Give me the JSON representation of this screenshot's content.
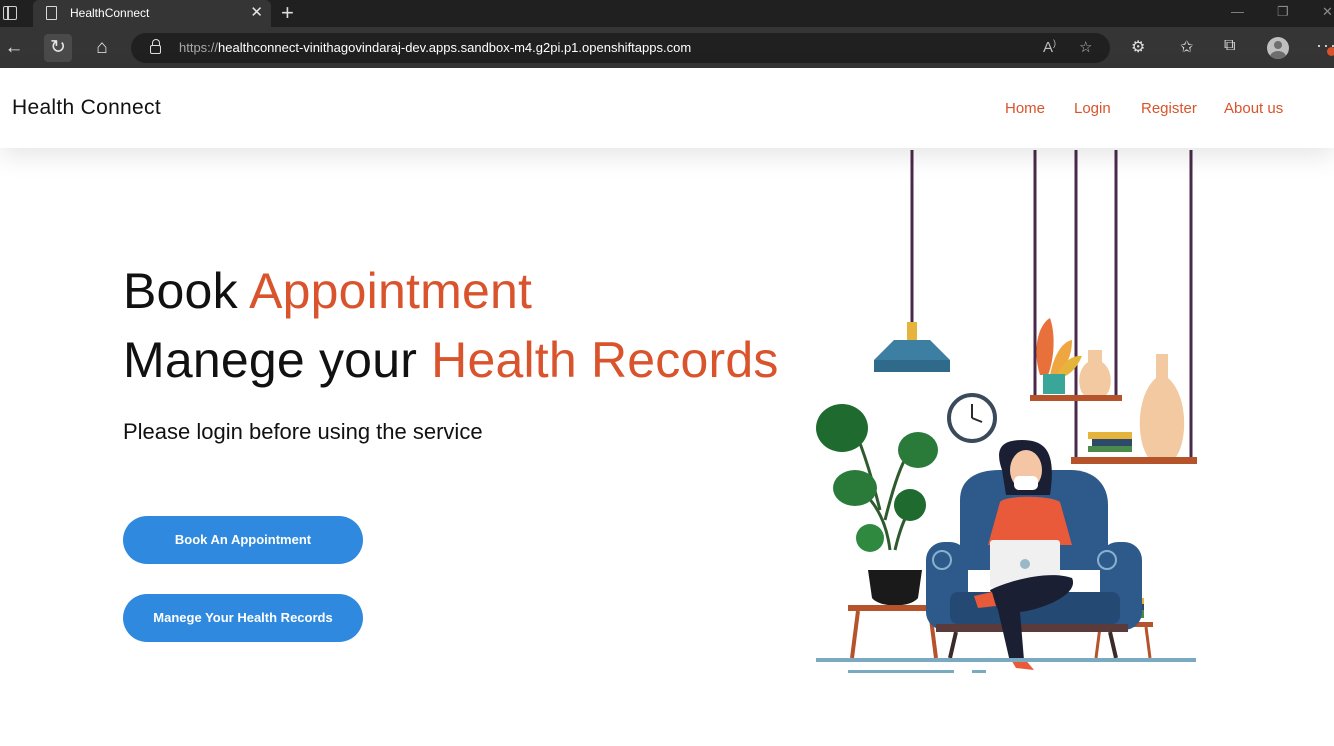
{
  "browser": {
    "tab_title": "HealthConnect",
    "url_protocol": "https://",
    "url_rest": "healthconnect-vinithagovindaraj-dev.apps.sandbox-m4.g2pi.p1.openshiftapps.com",
    "icons": [
      "sidebar-icon",
      "page-icon",
      "close-icon",
      "new-tab-icon",
      "back-icon",
      "refresh-icon",
      "home-icon",
      "lock-icon",
      "read-aloud-icon",
      "favorite-add-icon",
      "extensions-icon",
      "favorites-icon",
      "collections-icon",
      "profile-icon",
      "more-icon"
    ]
  },
  "navbar": {
    "brand": "Health Connect",
    "links": [
      "Home",
      "Login",
      "Register",
      "About us"
    ]
  },
  "hero": {
    "line1_plain": "Book ",
    "line1_accent": "Appointment",
    "line2_plain": "Manege your ",
    "line2_accent": "Health Records",
    "subtitle": "Please login before using the service",
    "buttons": [
      "Book An Appointment",
      "Manege Your Health Records"
    ]
  },
  "colors": {
    "accent": "#d9532c",
    "button_blue": "#2e89df",
    "chrome_dark": "#202020",
    "chrome_mid": "#353535"
  }
}
